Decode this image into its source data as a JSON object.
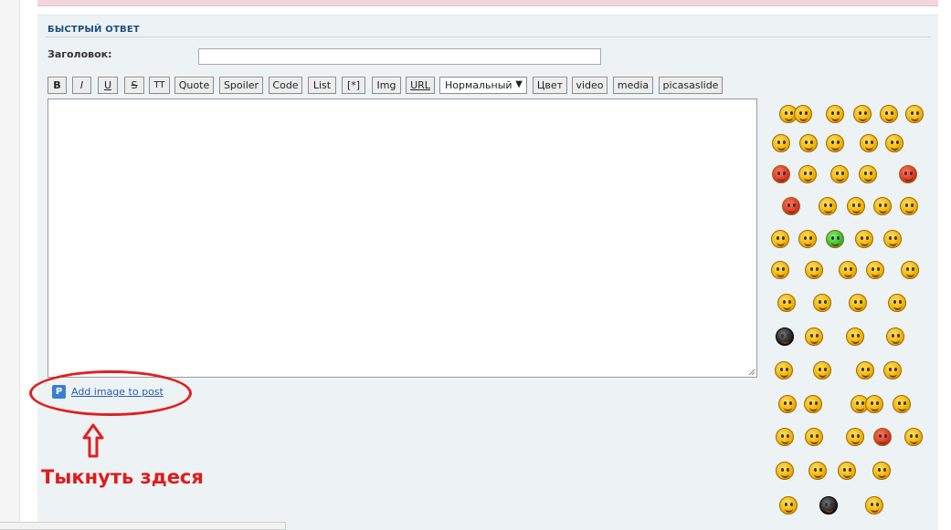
{
  "panel": {
    "title": "БЫСТРЫЙ ОТВЕТ"
  },
  "form": {
    "subject_label": "Заголовок:",
    "subject_value": "",
    "body_value": ""
  },
  "toolbar": {
    "buttons": [
      {
        "id": "b",
        "label": "B"
      },
      {
        "id": "i",
        "label": "I"
      },
      {
        "id": "u",
        "label": "U"
      },
      {
        "id": "s",
        "label": "S"
      },
      {
        "id": "tt",
        "label": "TT"
      },
      {
        "id": "quote",
        "label": "Quote"
      },
      {
        "id": "spoiler",
        "label": "Spoiler"
      },
      {
        "id": "code",
        "label": "Code"
      },
      {
        "id": "list",
        "label": "List"
      },
      {
        "id": "listitem",
        "label": "[*]"
      },
      {
        "id": "img",
        "label": "Img"
      },
      {
        "id": "url",
        "label": "URL"
      },
      {
        "id": "color",
        "label": "Цвет"
      },
      {
        "id": "video",
        "label": "video"
      },
      {
        "id": "media",
        "label": "media"
      },
      {
        "id": "picasa",
        "label": "picasaslide"
      }
    ],
    "font_size_selected": "Нормальный"
  },
  "addimage": {
    "label": "Add image to post",
    "icon": "picasa-p-icon"
  },
  "annotation": {
    "text": "Тыкнуть здеся",
    "color": "#e01b1b"
  },
  "colors": {
    "panel_bg": "#edf2f5",
    "title": "#1f4f7a",
    "link": "#2a5db0",
    "highlight": "#e02020"
  }
}
